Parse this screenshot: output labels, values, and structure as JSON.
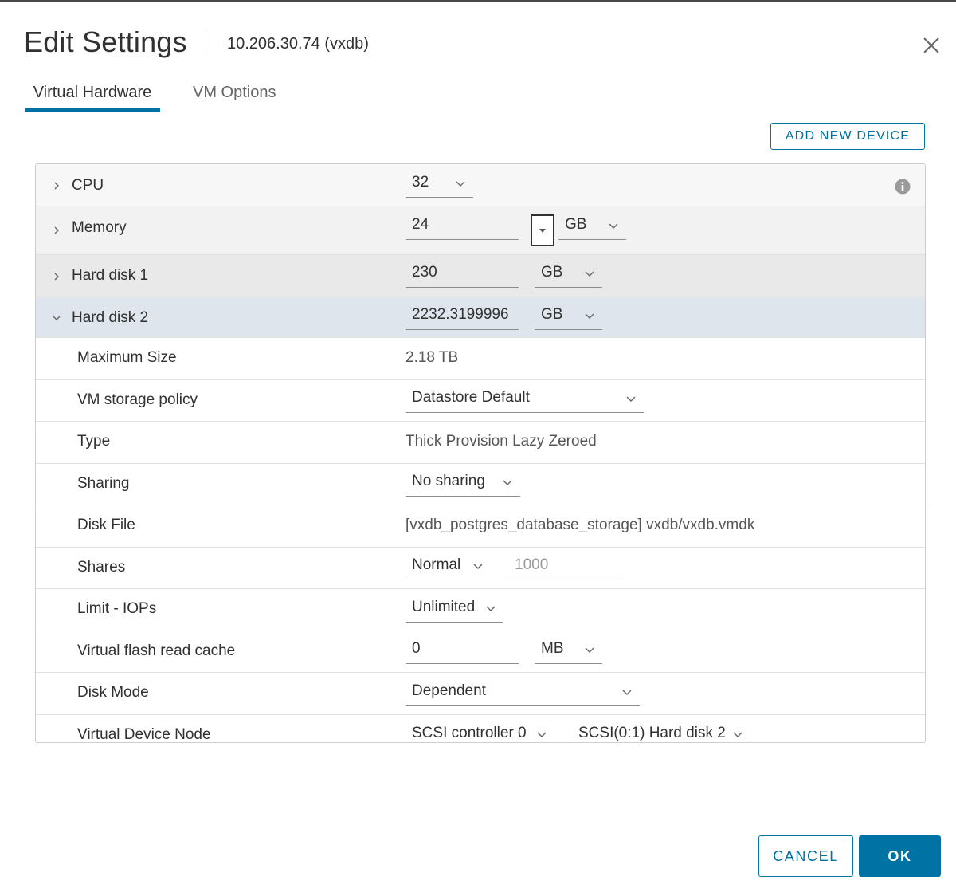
{
  "dialog": {
    "title": "Edit Settings",
    "subtitle": "10.206.30.74 (vxdb)",
    "close_icon": "close-icon"
  },
  "tabs": [
    {
      "label": "Virtual Hardware",
      "active": true
    },
    {
      "label": "VM Options",
      "active": false
    }
  ],
  "toolbar": {
    "add_new_device": "ADD NEW DEVICE"
  },
  "hardware": {
    "cpu": {
      "label": "CPU",
      "value": "32"
    },
    "memory": {
      "label": "Memory",
      "value": "24",
      "unit": "GB"
    },
    "hard_disk_1": {
      "label": "Hard disk 1",
      "value": "230",
      "unit": "GB"
    },
    "hard_disk_2": {
      "label": "Hard disk 2",
      "value": "2232.3199996",
      "unit": "GB",
      "details": {
        "max_size": {
          "label": "Maximum Size",
          "value": "2.18 TB"
        },
        "storage_policy": {
          "label": "VM storage policy",
          "value": "Datastore Default"
        },
        "type": {
          "label": "Type",
          "value": "Thick Provision Lazy Zeroed"
        },
        "sharing": {
          "label": "Sharing",
          "value": "No sharing"
        },
        "disk_file": {
          "label": "Disk File",
          "value": "[vxdb_postgres_database_storage] vxdb/vxdb.vmdk"
        },
        "shares": {
          "label": "Shares",
          "value": "Normal",
          "amount": "1000"
        },
        "limit_iops": {
          "label": "Limit - IOPs",
          "value": "Unlimited"
        },
        "flash_cache": {
          "label": "Virtual flash read cache",
          "value": "0",
          "unit": "MB"
        },
        "disk_mode": {
          "label": "Disk Mode",
          "value": "Dependent"
        },
        "device_node": {
          "label": "Virtual Device Node",
          "controller": "SCSI controller 0",
          "node": "SCSI(0:1) Hard disk 2"
        }
      }
    }
  },
  "footer": {
    "cancel": "CANCEL",
    "ok": "OK"
  },
  "colors": {
    "accent": "#0072a3",
    "selected_row": "#dfe5ec",
    "collapsed_row": "#f2f2f2",
    "grey_row": "#e9e9e9"
  }
}
